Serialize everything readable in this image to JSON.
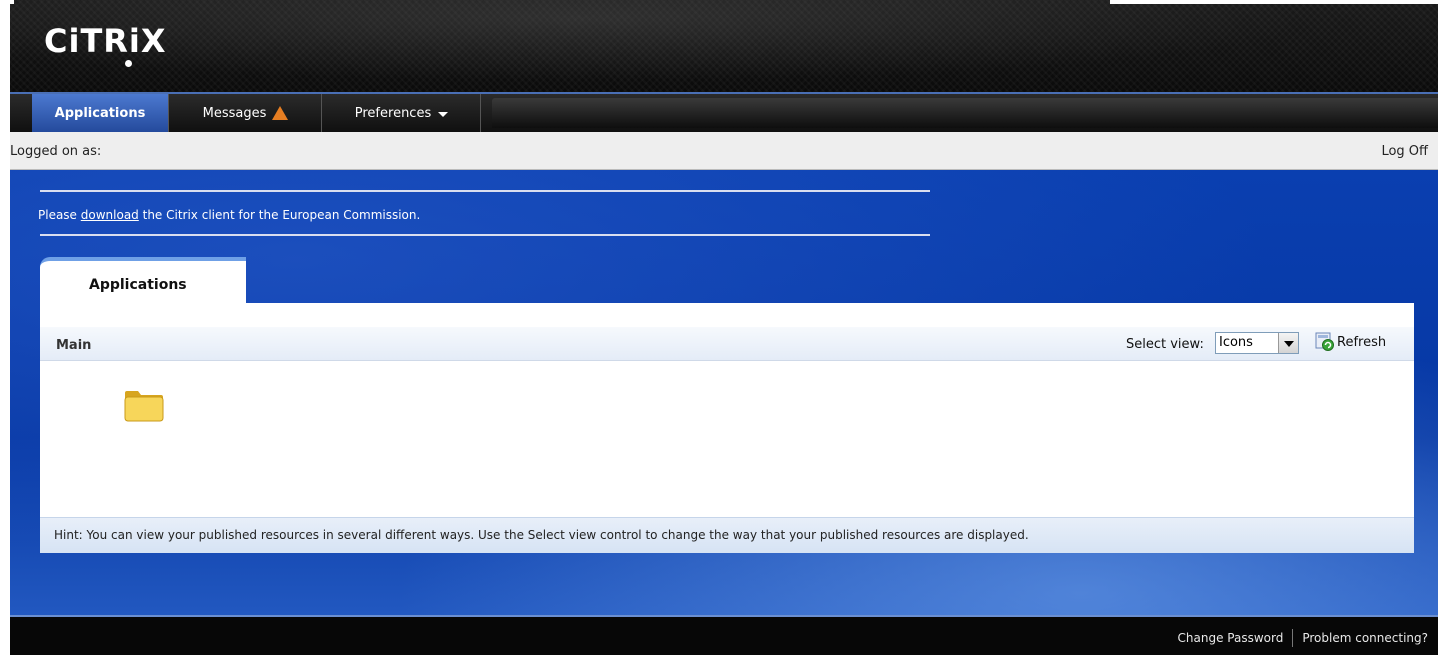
{
  "header": {
    "logo_text": "CiTRiX"
  },
  "nav": {
    "tabs": [
      {
        "label": "Applications",
        "active": true
      },
      {
        "label": "Messages",
        "icon": "warning-icon"
      },
      {
        "label": "Preferences",
        "icon": "chevron-down-icon"
      }
    ]
  },
  "status_bar": {
    "logged_on_label": "Logged on as:",
    "log_off": "Log Off"
  },
  "notice": {
    "prefix": "Please ",
    "link": "download",
    "suffix": " the Citrix client for the European Commission."
  },
  "panel": {
    "tab_label": "Applications",
    "section": "Main",
    "select_view_label": "Select view:",
    "select_view_value": "Icons",
    "refresh_label": "Refresh",
    "hint": "Hint: You can view your published resources in several different ways. Use the Select view control to change the way that your published resources are displayed."
  },
  "footer": {
    "change_password": "Change Password",
    "problem_connecting": "Problem connecting?"
  },
  "colors": {
    "accent_blue": "#0a3fb0",
    "warning": "#e67e22"
  }
}
